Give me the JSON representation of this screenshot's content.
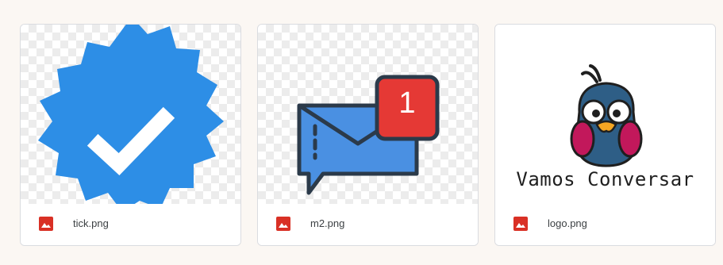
{
  "colors": {
    "page_bg": "#fbf7f3",
    "image_icon_red": "#d93025",
    "badge_red": "#e53935",
    "envelope_blue": "#4a90e2",
    "verified_blue": "#2d8ee6"
  },
  "files": [
    {
      "name": "tick.png",
      "icon": "image-file-icon",
      "preview": "verified-badge-icon"
    },
    {
      "name": "m2.png",
      "icon": "image-file-icon",
      "preview": "mail-notification-icon",
      "badge_count": "1"
    },
    {
      "name": "logo.png",
      "icon": "image-file-icon",
      "preview": "bird-logo",
      "logo_text": "Vamos Conversar"
    }
  ]
}
